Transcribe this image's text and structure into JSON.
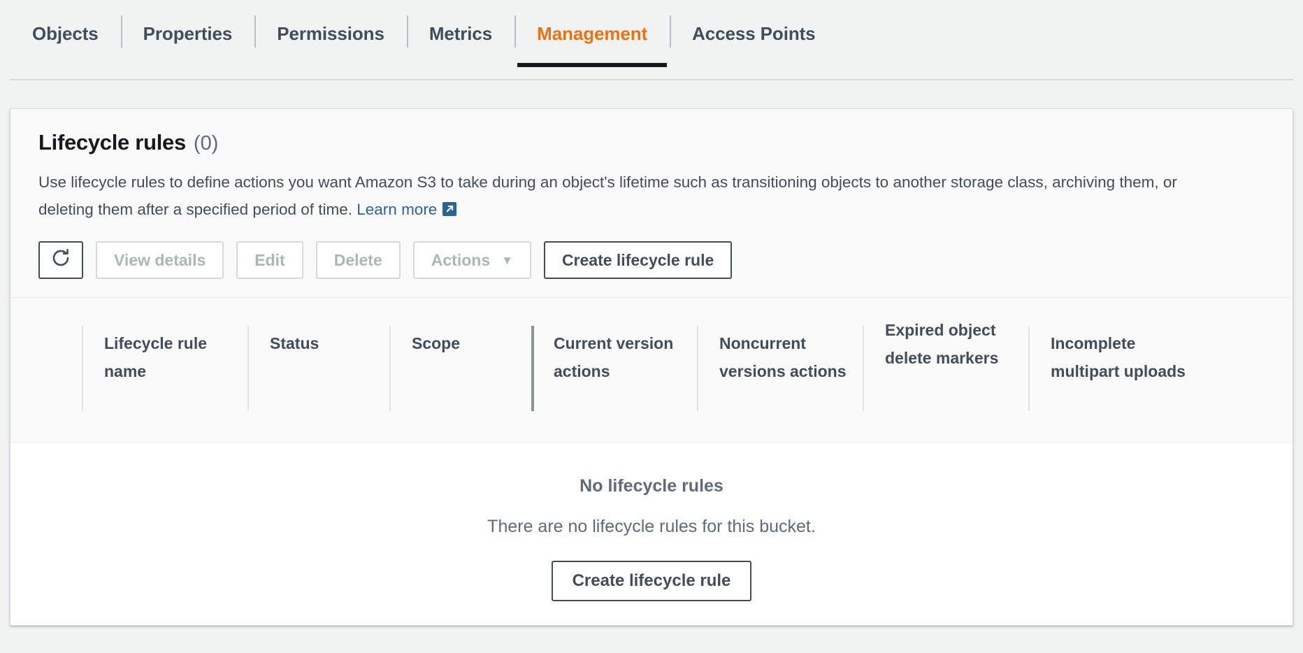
{
  "tabs": [
    {
      "label": "Objects",
      "active": false
    },
    {
      "label": "Properties",
      "active": false
    },
    {
      "label": "Permissions",
      "active": false
    },
    {
      "label": "Metrics",
      "active": false
    },
    {
      "label": "Management",
      "active": true
    },
    {
      "label": "Access Points",
      "active": false
    }
  ],
  "panel": {
    "title": "Lifecycle rules",
    "count": "(0)",
    "description_before_link": "Use lifecycle rules to define actions you want Amazon S3 to take during an object's lifetime such as transitioning objects to another storage class, archiving them, or deleting them after a specified period of time. ",
    "learn_more_label": "Learn more",
    "external_link_icon": "external-link-icon"
  },
  "toolbar": {
    "refresh_icon": "refresh-icon",
    "view_details_label": "View details",
    "edit_label": "Edit",
    "delete_label": "Delete",
    "actions_label": "Actions",
    "actions_caret_icon": "chevron-down-icon",
    "create_label": "Create lifecycle rule"
  },
  "table": {
    "columns": [
      {
        "label": "Lifecycle rule name"
      },
      {
        "label": "Status"
      },
      {
        "label": "Scope"
      },
      {
        "label": "Current version actions"
      },
      {
        "label": "Noncurrent versions actions"
      },
      {
        "label": "Expired object delete markers"
      },
      {
        "label": "Incomplete multipart uploads"
      }
    ]
  },
  "empty_state": {
    "title": "No lifecycle rules",
    "subtitle": "There are no lifecycle rules for this bucket.",
    "button_label": "Create lifecycle rule"
  },
  "colors": {
    "page_background": "#f1f3f3",
    "panel_background": "#ffffff",
    "header_background": "#fafafa",
    "active_tab": "#ec7211",
    "text_primary": "#16191f",
    "text_secondary": "#414d5c",
    "text_muted": "#5f6b7a",
    "link": "#2a6496",
    "disabled": "#aab7b8",
    "border": "#e9ebed"
  }
}
